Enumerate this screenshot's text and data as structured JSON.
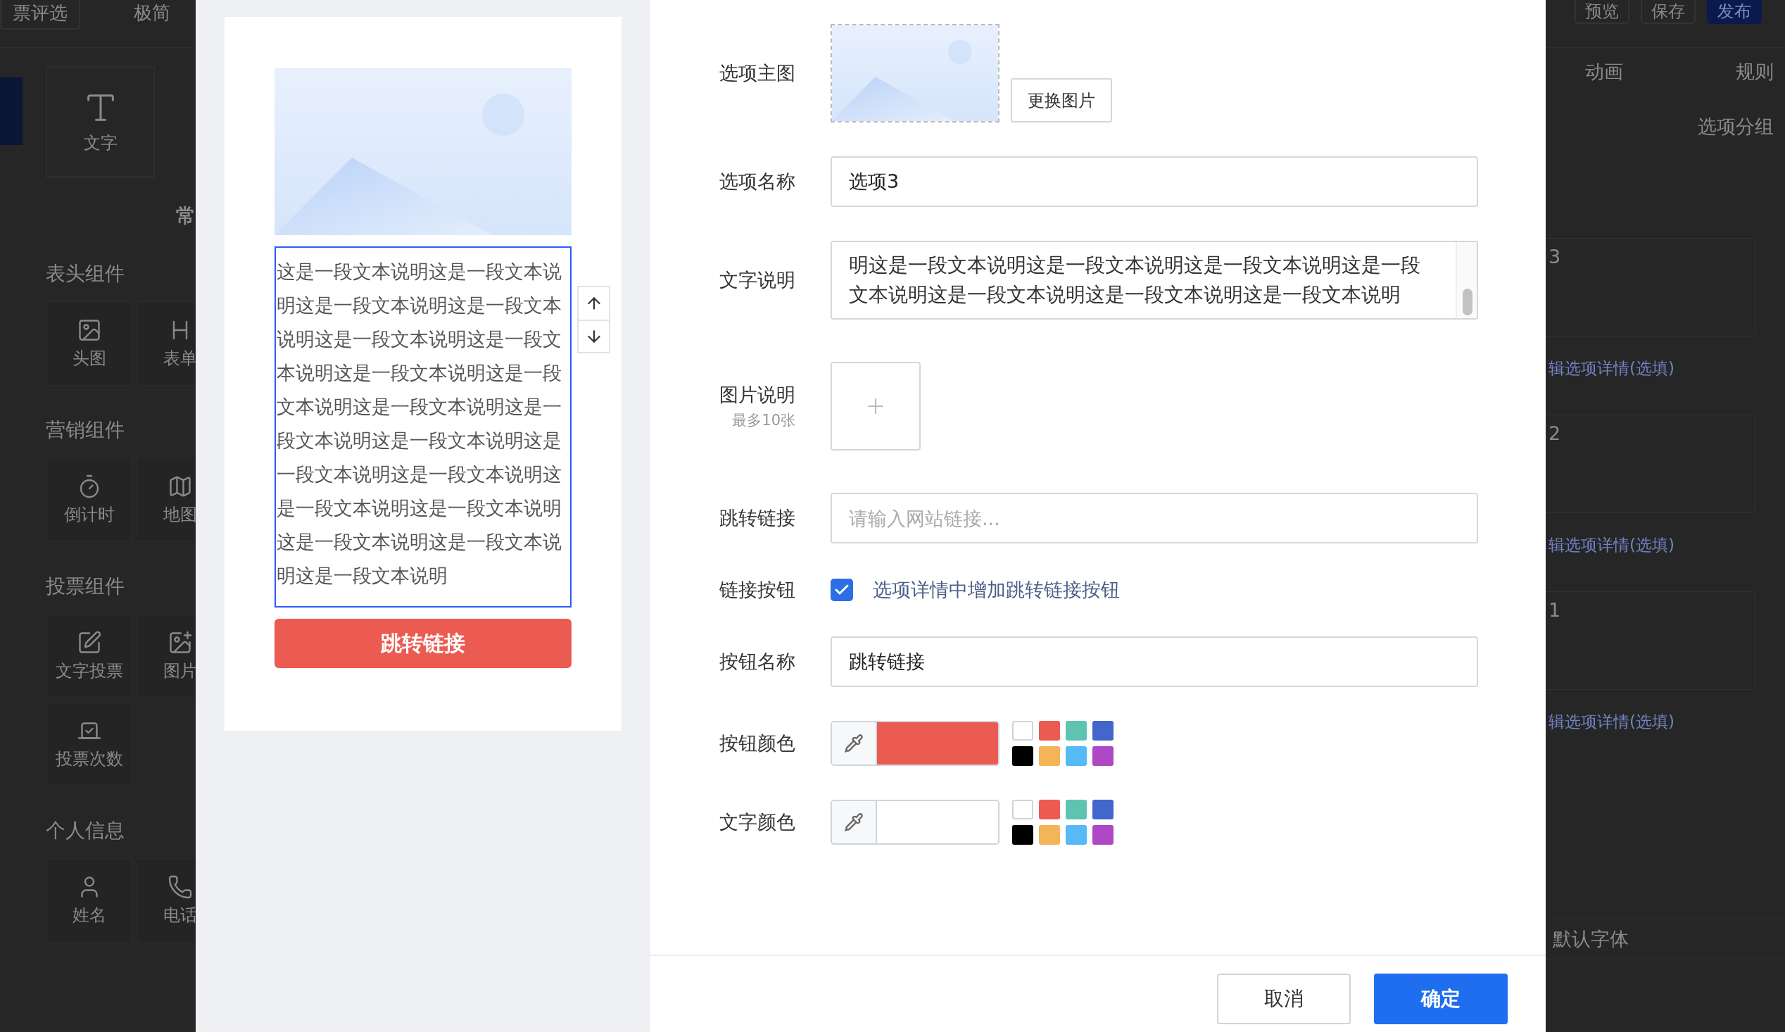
{
  "editor": {
    "topbar": {
      "tabs": [
        {
          "label": "票评选",
          "kind": "outline"
        },
        {
          "label": "极简",
          "kind": "plain"
        }
      ],
      "actions": [
        {
          "label": "预览",
          "kind": "outline"
        },
        {
          "label": "保存",
          "kind": "outline"
        },
        {
          "label": "发布",
          "kind": "primary"
        }
      ]
    },
    "sidebar": {
      "top_tiles": [
        {
          "label": "文字",
          "kind": "text"
        }
      ],
      "cut_heading": "常",
      "groups": [
        {
          "title": "表头组件",
          "items": [
            {
              "label": "头图",
              "kind": "image"
            },
            {
              "label": "表单",
              "kind": "title"
            }
          ]
        },
        {
          "title": "营销组件",
          "items": [
            {
              "label": "倒计时",
              "kind": "timer"
            },
            {
              "label": "地图",
              "kind": "map"
            }
          ]
        },
        {
          "title": "投票组件",
          "items": [
            {
              "label": "文字投票",
              "kind": "textvote"
            },
            {
              "label": "图片",
              "kind": "imagevote"
            },
            {
              "label": "投票次数",
              "kind": "count"
            }
          ]
        },
        {
          "title": "个人信息",
          "items": [
            {
              "label": "姓名",
              "kind": "user"
            },
            {
              "label": "电话",
              "kind": "phone"
            }
          ]
        }
      ]
    },
    "right_panel": {
      "tabs": [
        "动画",
        "规则"
      ],
      "heading": "选项分组",
      "options": [
        {
          "name": "3",
          "link": "辑选项详情(选填)"
        },
        {
          "name": "2",
          "link": "辑选项详情(选填)"
        },
        {
          "name": "1",
          "link": "辑选项详情(选填)"
        }
      ],
      "font_label": "默认字体"
    }
  },
  "dialog": {
    "preview": {
      "description": "这是一段文本说明这是一段文本说明这是一段文本说明这是一段文本说明这是一段文本说明这是一段文本说明这是一段文本说明这是一段文本说明这是一段文本说明这是一段文本说明这是一段文本说明这是一段文本说明这是一段文本说明这是一段文本说明这是一段文本说明这是一段文本说明这是一段文本说明这是一段文本说明",
      "button_label": "跳转链接"
    },
    "fields": [
      {
        "kind": "image",
        "label": "选项主图",
        "button": "更换图片"
      },
      {
        "kind": "input",
        "label": "选项名称",
        "value": "选项3"
      },
      {
        "kind": "textarea",
        "label": "文字说明",
        "value": "明这是一段文本说明这是一段文本说明这是一段文本说明这是一段文本说明这是一段文本说明这是一段文本说明这是一段文本说明"
      },
      {
        "kind": "upload",
        "label": "图片说明",
        "hint": "最多10张"
      },
      {
        "kind": "input",
        "label": "跳转链接",
        "placeholder": "请输入网站链接..."
      },
      {
        "kind": "checkbox",
        "label": "链接按钮",
        "text": "选项详情中增加跳转链接按钮",
        "checked": true
      },
      {
        "kind": "input",
        "label": "按钮名称",
        "value": "跳转链接"
      },
      {
        "kind": "color",
        "label": "按钮颜色",
        "color": "#eb5b52",
        "swatches": [
          {
            "color": "#ffffff"
          },
          {
            "color": "#eb5b52"
          },
          {
            "color": "#5ec4b1"
          },
          {
            "color": "#4266cc"
          },
          {
            "color": "#000000"
          },
          {
            "color": "#f4b458"
          },
          {
            "color": "#56b9f8"
          },
          {
            "color": "#b047c4"
          }
        ]
      },
      {
        "kind": "color",
        "label": "文字颜色",
        "color": "#ffffff",
        "swatches": [
          {
            "color": "#ffffff"
          },
          {
            "color": "#eb5b52"
          },
          {
            "color": "#5ec4b1"
          },
          {
            "color": "#4266cc"
          },
          {
            "color": "#000000"
          },
          {
            "color": "#f4b458"
          },
          {
            "color": "#56b9f8"
          },
          {
            "color": "#b047c4"
          }
        ]
      }
    ],
    "footer": [
      {
        "label": "取消",
        "kind": "secondary"
      },
      {
        "label": "确定",
        "kind": "primary"
      }
    ]
  }
}
